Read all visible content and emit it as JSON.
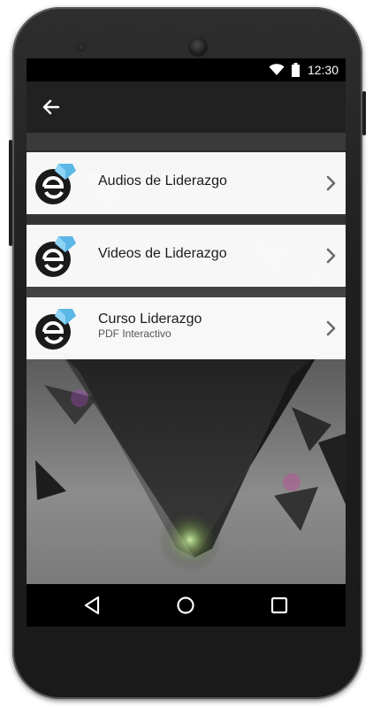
{
  "status_bar": {
    "time": "12:30",
    "icons": [
      "wifi-icon",
      "battery-icon"
    ]
  },
  "app_bar": {
    "back_icon": "arrow-left-icon"
  },
  "menu": {
    "items": [
      {
        "title": "Audios de Liderazgo",
        "subtitle": "",
        "icon": "app-logo-icon"
      },
      {
        "title": "Videos de Liderazgo",
        "subtitle": "",
        "icon": "app-logo-icon"
      },
      {
        "title": "Curso Liderazgo",
        "subtitle": "PDF Interactivo",
        "icon": "app-logo-icon"
      }
    ],
    "chevron_icon": "chevron-right-icon"
  },
  "nav_bar": {
    "icons": [
      "back-triangle-icon",
      "home-circle-icon",
      "recents-square-icon"
    ]
  },
  "colors": {
    "app_bar": "#212121",
    "status_bar": "#000000",
    "menu_item_bg": "#ffffff",
    "logo_blue": "#5ab7e6"
  }
}
